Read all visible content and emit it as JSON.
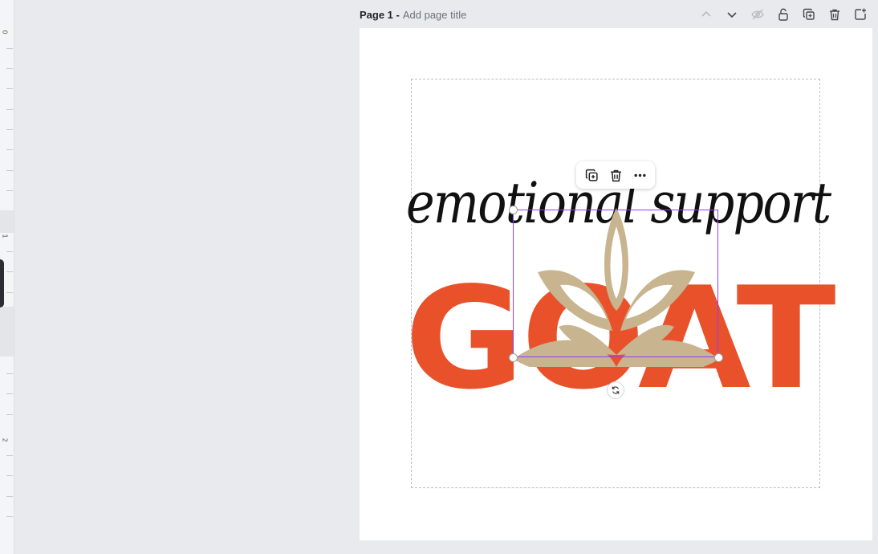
{
  "header": {
    "page_label": "Page 1 -",
    "add_title_placeholder": "Add page title"
  },
  "ruler": {
    "marks": [
      "0",
      "1",
      "2"
    ]
  },
  "canvas": {
    "script_text": "emotional support",
    "goat_text": "GOAT",
    "colors": {
      "goat": "#e9512a",
      "leaf": "#c8b48f",
      "selection": "#8b3dff"
    }
  },
  "icons": {
    "page_actions": [
      "chevron-up-icon",
      "chevron-down-icon",
      "eye-slash-icon",
      "lock-icon",
      "duplicate-icon",
      "trash-icon",
      "add-page-icon"
    ],
    "element_toolbar": [
      "duplicate-icon",
      "trash-icon",
      "more-icon"
    ],
    "rotate": "rotate-icon"
  }
}
